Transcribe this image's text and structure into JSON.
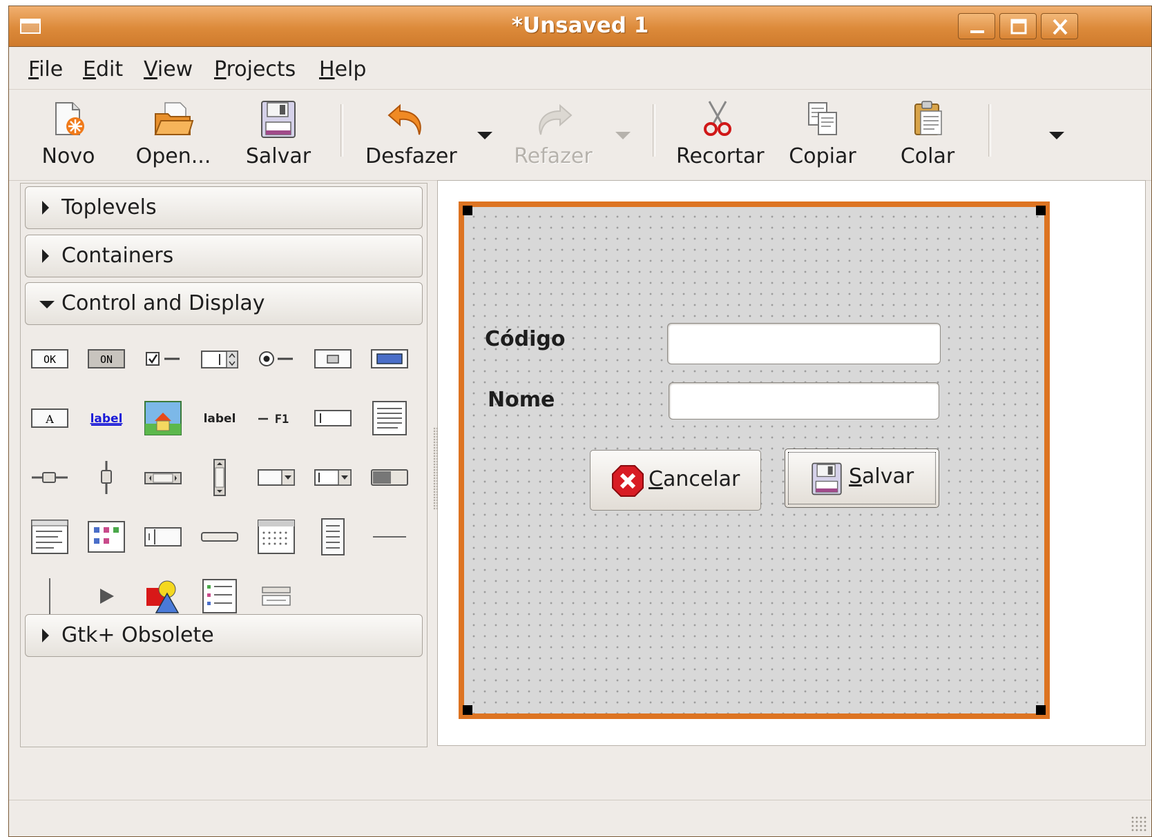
{
  "window": {
    "title": "*Unsaved 1"
  },
  "menu": [
    "File",
    "Edit",
    "View",
    "Projects",
    "Help"
  ],
  "toolbar": {
    "novo": "Novo",
    "open": "Open...",
    "salvar": "Salvar",
    "desfazer": "Desfazer",
    "refazer": "Refazer",
    "recortar": "Recortar",
    "copiar": "Copiar",
    "colar": "Colar"
  },
  "palette": {
    "groups": {
      "toplevels": "Toplevels",
      "containers": "Containers",
      "control": "Control and Display",
      "obsolete": "Gtk+ Obsolete"
    },
    "icon_text": {
      "ok": "OK",
      "on": "ON",
      "a": "A",
      "label_link": "label",
      "label_bold": "label",
      "f1": "F1"
    }
  },
  "form": {
    "codigo_label": "Código",
    "nome_label": "Nome",
    "codigo_value": "",
    "nome_value": "",
    "cancel_first": "C",
    "cancel_rest": "ancelar",
    "save_first": "S",
    "save_rest": "alvar"
  },
  "colors": {
    "accent": "#dd7422",
    "title_bar": "#dc8a3a"
  }
}
